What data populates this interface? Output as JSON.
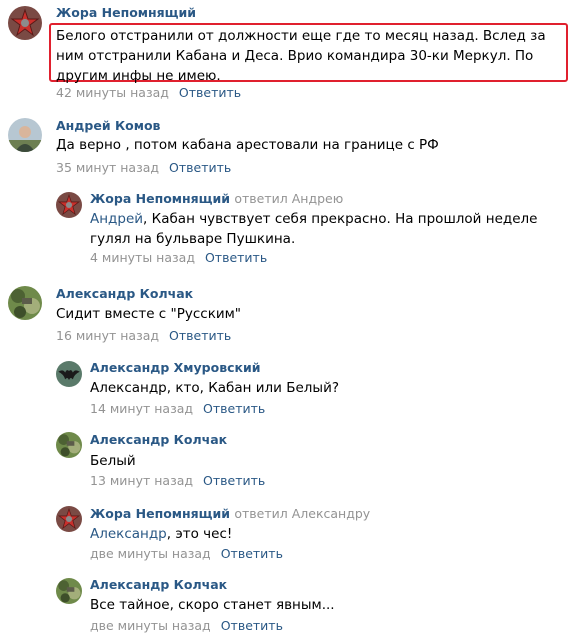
{
  "accent": "#2a5885",
  "highlight": "#e0202e",
  "comments": [
    {
      "author": "Жора Непомнящий",
      "text": "Белого отстранили от должности еще где то месяц назад. Вслед за ним отстранили Кабана и Деса. Врио командира 30-ки Меркул. По другим инфы не имею.",
      "time": "42 минуты назад",
      "reply": "Ответить",
      "avatar": "star-icon"
    },
    {
      "author": "Андрей Комов",
      "text": "Да верно , потом кабана арестовали на границе с РФ",
      "time": "35 минут назад",
      "reply": "Ответить",
      "avatar": "person-photo"
    },
    {
      "author": "Жора Непомнящий",
      "replied_to": "ответил Андрею",
      "mention": "Андрей",
      "text": ", Кабан чувствует себя прекрасно. На прошлой неделе гулял на бульваре Пушкина.",
      "time": "4 минуты назад",
      "reply": "Ответить",
      "avatar": "star-icon"
    },
    {
      "author": "Александр Колчак",
      "text": "Сидит вместе с \"Русским\"",
      "time": "16 минут назад",
      "reply": "Ответить",
      "avatar": "camo-photo"
    },
    {
      "author": "Александр Хмуровский",
      "text": "Александр, кто, Кабан или Белый?",
      "time": "14 минут назад",
      "reply": "Ответить",
      "avatar": "bat-emblem-icon"
    },
    {
      "author": "Александр Колчак",
      "text": "Белый",
      "time": "13 минут назад",
      "reply": "Ответить",
      "avatar": "camo-photo"
    },
    {
      "author": "Жора Непомнящий",
      "replied_to": "ответил Александру",
      "mention": "Александр",
      "text": ", это чес!",
      "time": "две минуты назад",
      "reply": "Ответить",
      "avatar": "star-icon"
    },
    {
      "author": "Александр Колчак",
      "text": "Все тайное, скоро станет явным...",
      "time": "две минуты назад",
      "reply": "Ответить",
      "avatar": "camo-photo"
    }
  ]
}
